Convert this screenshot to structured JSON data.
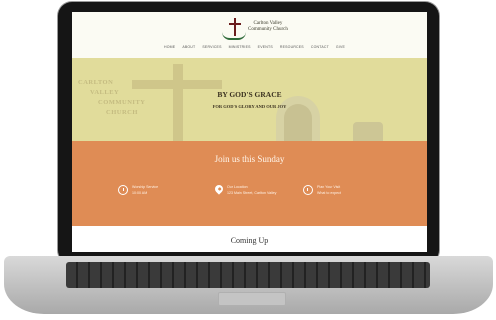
{
  "header": {
    "logo_line1": "Carlton Valley",
    "logo_line2": "Community Church",
    "nav": [
      "HOME",
      "ABOUT",
      "SERVICES",
      "MINISTRIES",
      "EVENTS",
      "RESOURCES",
      "CONTACT",
      "GIVE"
    ]
  },
  "hero": {
    "background_lines": [
      "CARLTON",
      "VALLEY",
      "COMMUNITY",
      "CHURCH"
    ],
    "title": "BY GOD'S GRACE",
    "subtitle": "FOR GOD'S GLORY AND OUR JOY"
  },
  "sunday": {
    "title": "Join us this Sunday",
    "items": [
      {
        "icon": "clock-icon",
        "line1": "Worship Service",
        "line2": "10:00 AM"
      },
      {
        "icon": "map-pin-icon",
        "line1": "Our Location",
        "line2": "123 Main Street, Carlton Valley"
      },
      {
        "icon": "alert-icon",
        "line1": "Plan Your Visit",
        "line2": "What to expect"
      }
    ]
  },
  "coming": {
    "title": "Coming Up"
  },
  "colors": {
    "hero": "#e1dc9b",
    "band": "#df8c55",
    "accent": "#6b1d1d"
  }
}
